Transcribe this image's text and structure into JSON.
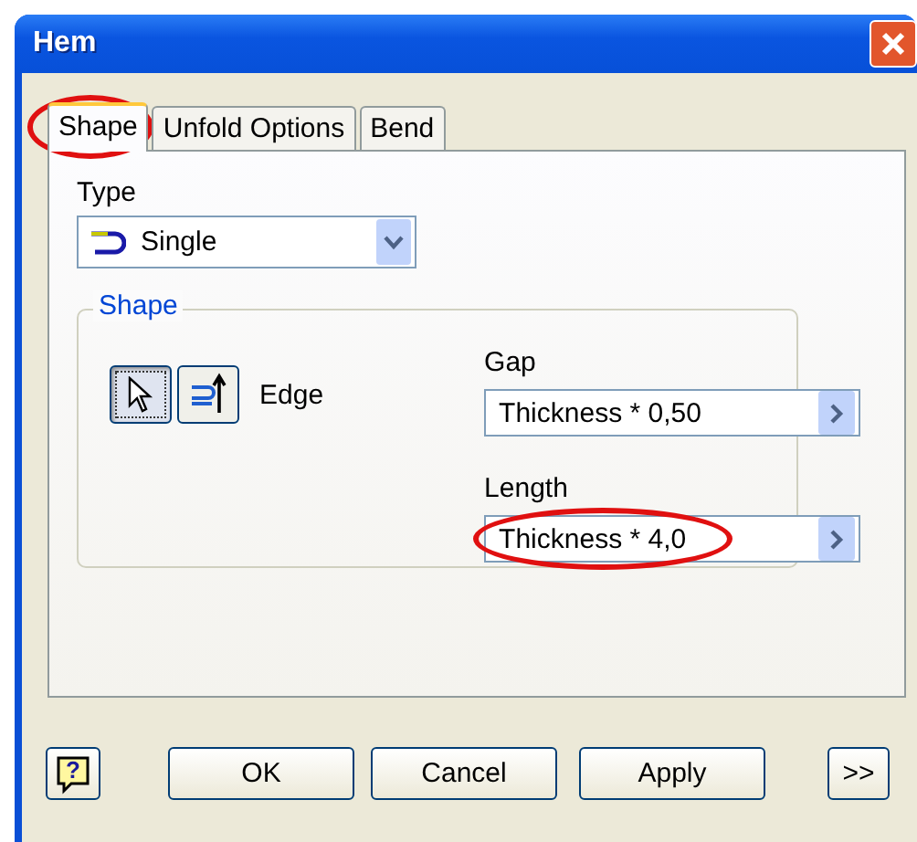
{
  "window": {
    "title": "Hem"
  },
  "tabs": [
    {
      "label": "Shape",
      "selected": true,
      "circled": true
    },
    {
      "label": "Unfold Options",
      "selected": false,
      "circled": false
    },
    {
      "label": "Bend",
      "selected": false,
      "circled": false
    }
  ],
  "type": {
    "label": "Type",
    "value": "Single"
  },
  "shape_group": {
    "title": "Shape",
    "tools": [
      {
        "kind": "select",
        "selected": true
      },
      {
        "kind": "edge",
        "selected": false
      }
    ],
    "edge_label": "Edge",
    "fields": [
      {
        "label": "Gap",
        "value": "Thickness * 0,50",
        "circled": false
      },
      {
        "label": "Length",
        "value": "Thickness * 4,0",
        "circled": true
      }
    ]
  },
  "buttons": [
    {
      "label": "OK"
    },
    {
      "label": "Cancel"
    },
    {
      "label": "Apply"
    }
  ],
  "help_button": "?",
  "more_button": ">>"
}
